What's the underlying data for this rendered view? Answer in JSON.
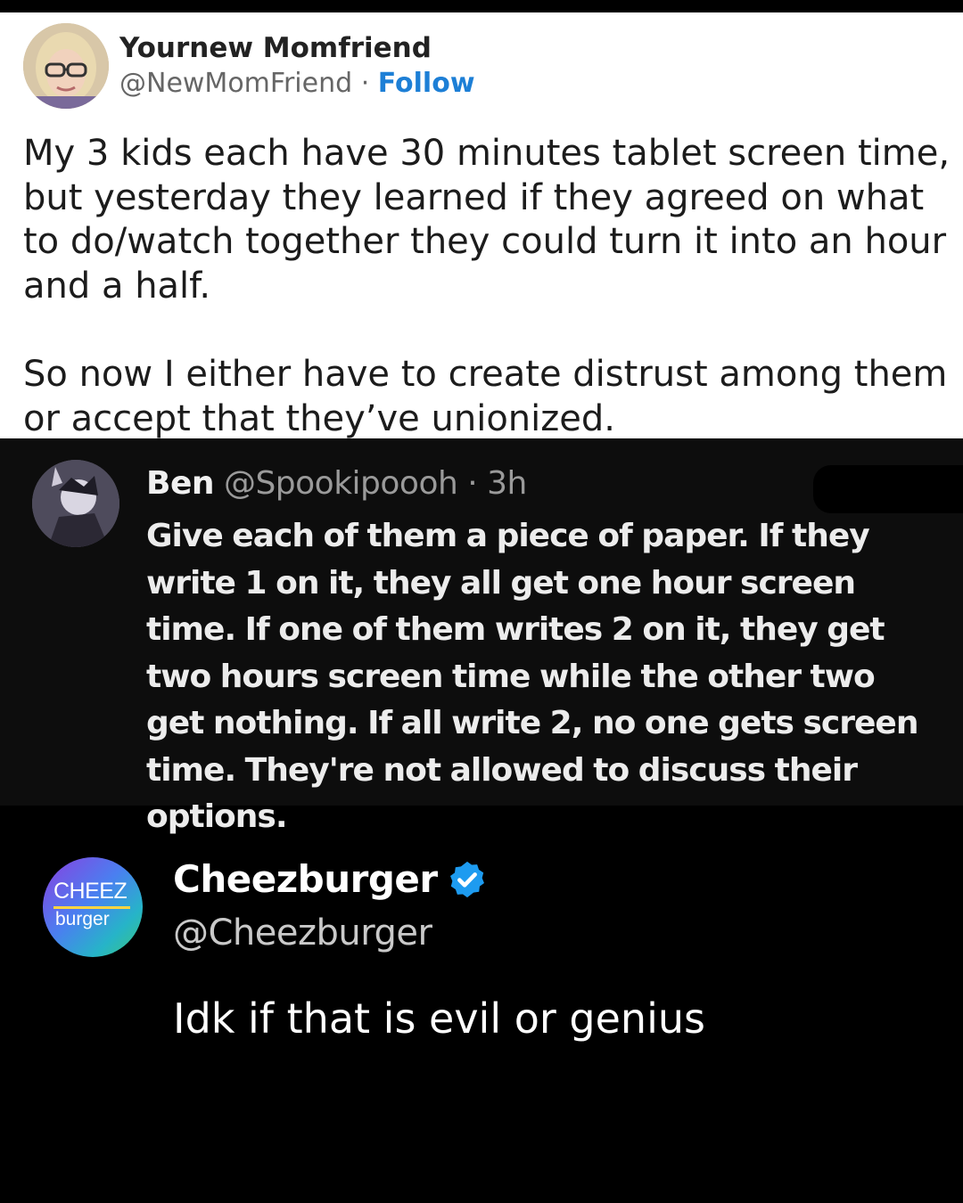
{
  "tweet1": {
    "display_name": "Yournew Momfriend",
    "handle": "@NewMomFriend",
    "separator": " · ",
    "follow_label": "Follow",
    "paragraph1": "My 3 kids each have 30 minutes tablet screen time, but yesterday they learned if they agreed on what to do/watch together they could turn it into an hour and a half.",
    "paragraph2": "So now I either have to create distrust among them or accept that they’ve unionized."
  },
  "tweet2": {
    "display_name": "Ben",
    "handle": "@Spookipoooh",
    "separator": " · ",
    "time": "3h",
    "body": "Give each of them a piece of paper. If they write 1 on it, they all get one hour screen time. If one of them writes 2 on it, they get two hours screen time while the other two get nothing. If all write 2, no one gets screen time. They're not allowed to discuss their options."
  },
  "tweet3": {
    "display_name": "Cheezburger",
    "handle": "@Cheezburger",
    "text": "Idk if that is evil or genius",
    "avatar_logo_line1": "CHEEZ",
    "avatar_logo_line2": "burger",
    "verified_color": "#1d9bf0"
  },
  "colors": {
    "follow_link": "#1d7fd6",
    "reply_background": "#0d0d0d",
    "page_background": "#000000"
  }
}
